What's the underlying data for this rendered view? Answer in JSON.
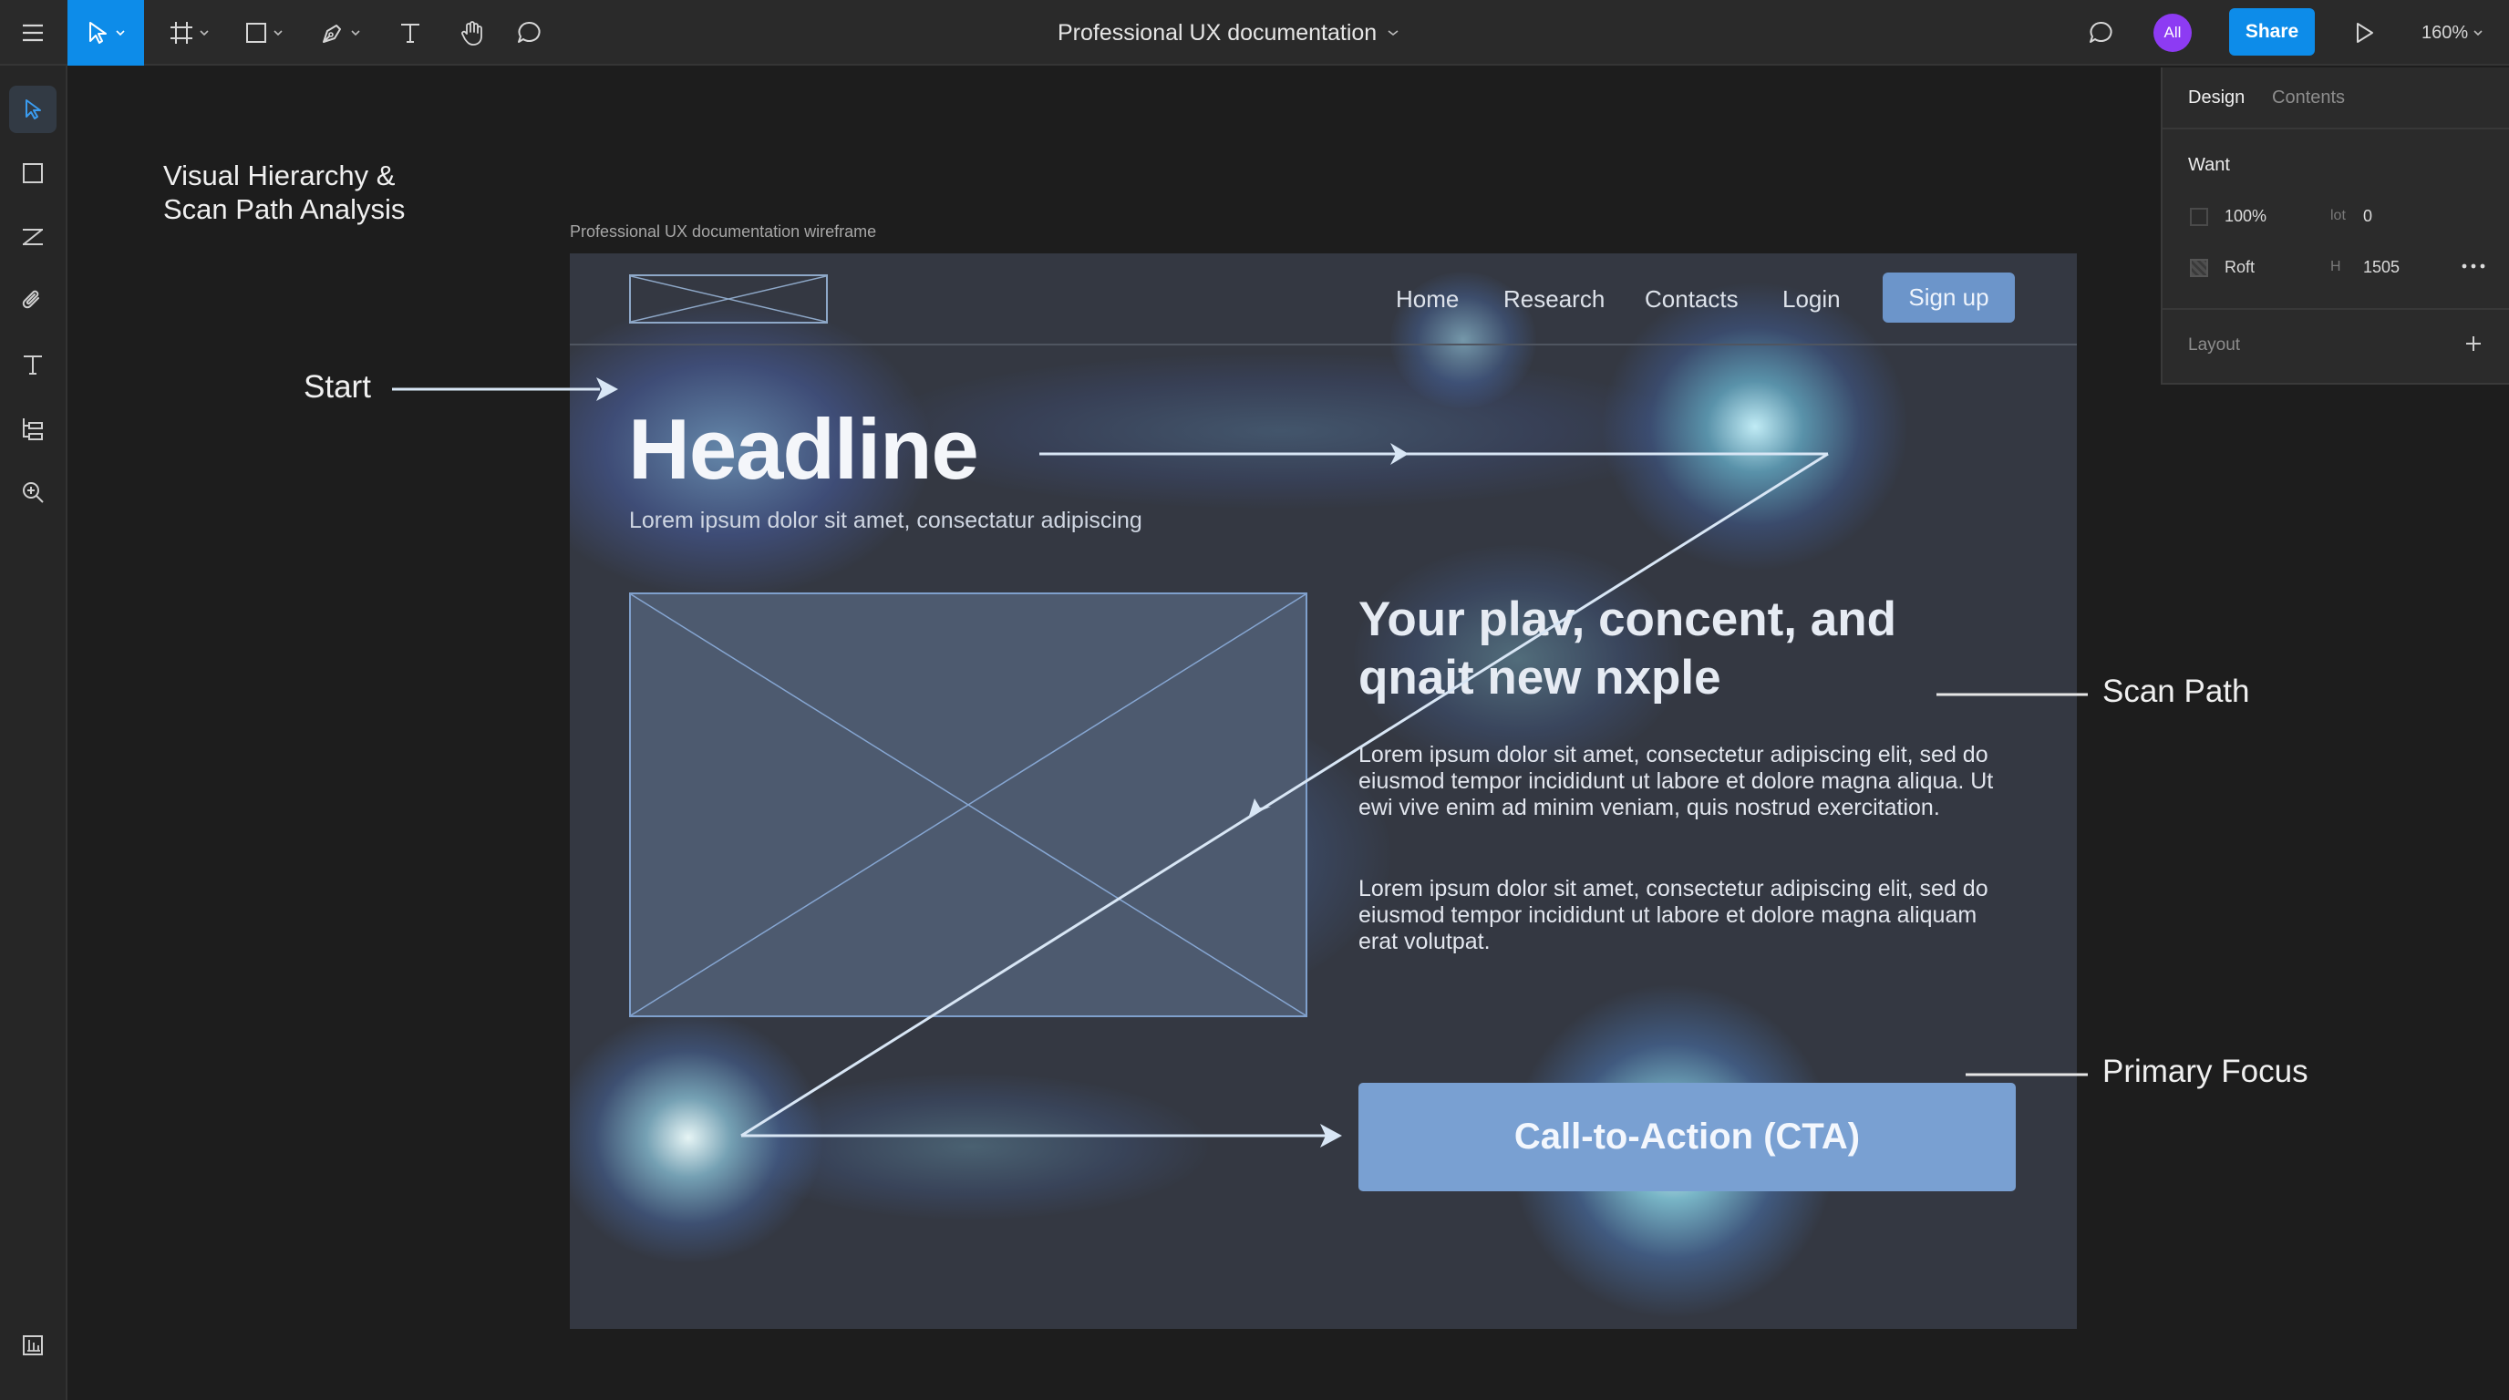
{
  "app": {
    "document_title": "Professional UX documentation",
    "avatar_initials": "All",
    "share_label": "Share",
    "zoom_level": "160%"
  },
  "toolbar": {
    "tools": [
      "menu-icon",
      "move-tool-icon",
      "frame-tool-icon",
      "rectangle-tool-icon",
      "pen-tool-icon",
      "text-tool-icon",
      "hand-tool-icon",
      "comment-tool-icon"
    ],
    "active_tool": "move-tool-icon",
    "right_icons": [
      "comment-icon",
      "present-play-icon"
    ]
  },
  "left_rail": {
    "tools": [
      "cursor-icon",
      "rectangle-icon",
      "line-icon",
      "attachment-icon",
      "text-icon",
      "layers-icon",
      "zoom-icon",
      "bottom-panel-icon"
    ],
    "active_tool": "cursor-icon"
  },
  "canvas": {
    "annotation_title": "Visual Hierarchy &\nScan Path Analysis",
    "frame_label": "Professional UX documentation wireframe",
    "annotations": {
      "start": "Start",
      "scan_path": "Scan Path",
      "primary_focus": "Primary Focus"
    }
  },
  "wireframe": {
    "nav": [
      "Home",
      "Research",
      "Contacts",
      "Login"
    ],
    "signup_label": "Sign up",
    "headline": "Headline",
    "subheadline": "Lorem ipsum dolor sit amet, consectatur adipiscing",
    "section_heading": "Your plav, concent, and qnait new nxple",
    "paragraph_1": "Lorem ipsum dolor sit amet, consectetur adipiscing elit, sed do eiusmod tempor incididunt ut labore et dolore magna aliqua. Ut ewi vive enim ad minim veniam, quis nostrud exercitation.",
    "paragraph_2": "Lorem ipsum dolor sit amet, consectetur adipiscing elit, sed do eiusmod tempor incididunt ut labore et dolore magna aliquam erat volutpat.",
    "cta_label": "Call-to-Action (CTA)"
  },
  "design_panel": {
    "tabs": [
      "Design",
      "Contents"
    ],
    "active_tab": "Design",
    "section_title": "Want",
    "row1": {
      "value": "100%",
      "dim_label": "lot",
      "dim_value": "0"
    },
    "row2": {
      "value": "Roft",
      "dim_label": "H",
      "dim_value": "1505"
    },
    "layout_label": "Layout"
  },
  "colors": {
    "accent": "#0d8ce9",
    "avatar": "#8d3bf3",
    "heatmap_glow": "#7fe6ff",
    "wireframe_stroke": "#7fa0cc"
  }
}
